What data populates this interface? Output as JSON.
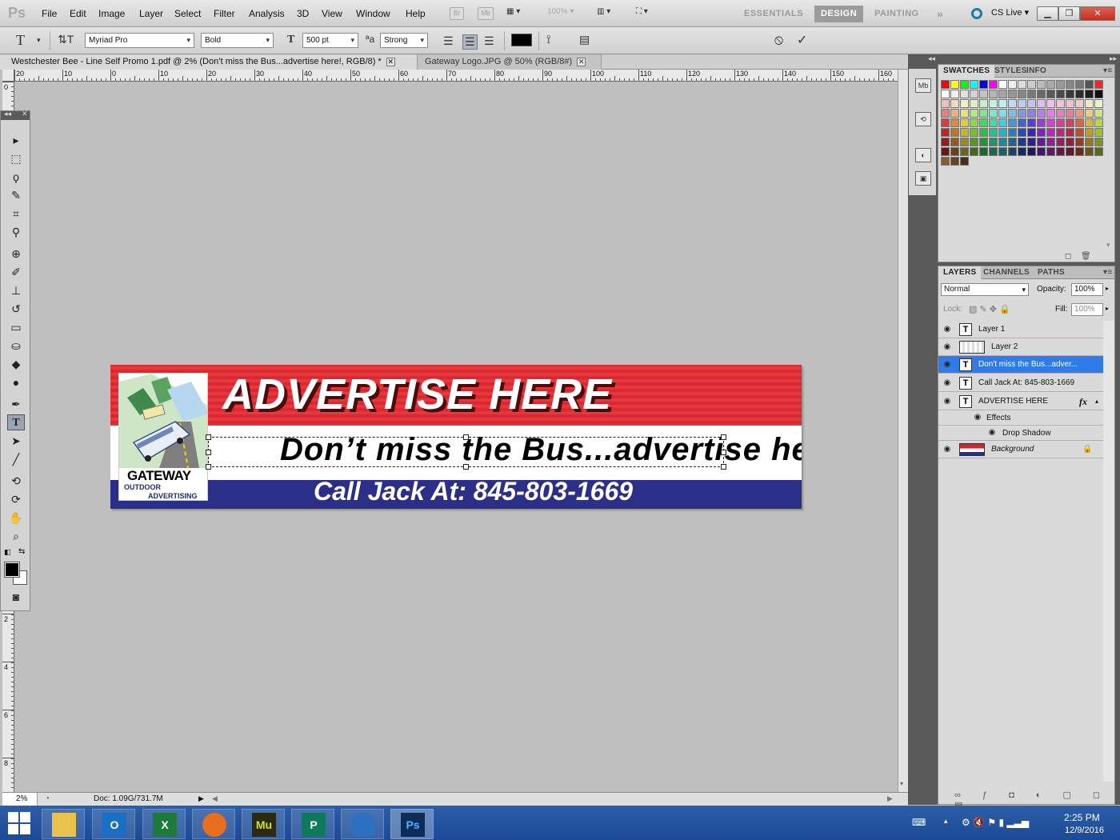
{
  "app": {
    "logo": "Ps",
    "menu": [
      "File",
      "Edit",
      "Image",
      "Layer",
      "Select",
      "Filter",
      "Analysis",
      "3D",
      "View",
      "Window",
      "Help"
    ],
    "zoom_readout": "100%",
    "bridge_icon": "Br",
    "mini_bridge_icon": "Mb",
    "workspaces": [
      "ESSENTIALS",
      "DESIGN",
      "PAINTING"
    ],
    "active_workspace": "DESIGN",
    "more_workspaces": "»",
    "cs_live": "CS Live"
  },
  "options": {
    "font_family": "Myriad Pro",
    "font_style": "Bold",
    "font_size": "500 pt",
    "antialias": "Strong",
    "cancel_glyph": "⦸",
    "commit_glyph": "✓"
  },
  "tabs": [
    {
      "label": "Westchester Bee - Line Self Promo 1.pdf @ 2% (Don’t miss the Bus...advertise here!, RGB/8) *",
      "close": "✕"
    },
    {
      "label": "Gateway Logo.JPG @ 50% (RGB/8#)",
      "close": "✕"
    }
  ],
  "ruler": {
    "top_labels": [
      "20",
      "10",
      "0",
      "10",
      "20",
      "30",
      "40",
      "50",
      "60",
      "70",
      "80",
      "90",
      "100",
      "110",
      "120",
      "130",
      "140",
      "150",
      "160"
    ],
    "left_labels": [
      "0",
      "2",
      "4",
      "6",
      "8"
    ]
  },
  "artwork": {
    "headline": "ADVERTISE HERE",
    "subline": "Don’t miss the Bus...advertise here!",
    "phone": "Call Jack At: 845-803-1669",
    "logo_name": "GATEWAY",
    "logo_sub1": "OUTDOOR",
    "logo_sub2": "ADVERTISING"
  },
  "status": {
    "zoom": "2%",
    "doc": "Doc: 1.09G/731.7M"
  },
  "swatches_panel": {
    "tabs": [
      "SWATCHES",
      "STYLES",
      "INFO"
    ],
    "active_tab": "SWATCHES"
  },
  "layers_panel": {
    "tabs": [
      "LAYERS",
      "CHANNELS",
      "PATHS"
    ],
    "active_tab": "LAYERS",
    "blend_mode": "Normal",
    "opacity_label": "Opacity:",
    "opacity": "100%",
    "lock_label": "Lock:",
    "fill_label": "Fill:",
    "fill": "100%",
    "layers": [
      {
        "name": "Layer 1",
        "type": "text",
        "selected": false
      },
      {
        "name": "Layer 2",
        "type": "pixel",
        "selected": false
      },
      {
        "name": "Don't miss the Bus...adver...",
        "type": "text",
        "selected": true
      },
      {
        "name": "Call Jack At: 845-803-1669",
        "type": "text",
        "selected": false
      },
      {
        "name": "ADVERTISE HERE",
        "type": "text",
        "selected": false,
        "fx": "fx"
      }
    ],
    "effects_label": "Effects",
    "drop_shadow_label": "Drop Shadow",
    "background_label": "Background"
  },
  "taskbar": {
    "time": "2:25 PM",
    "date": "12/9/2016",
    "apps": [
      "explorer",
      "outlook",
      "excel",
      "firefox",
      "muse",
      "publisher",
      "app6",
      "photoshop"
    ],
    "app_letters": [
      "",
      "O",
      "X",
      "",
      "Mu",
      "P",
      "",
      "Ps"
    ]
  },
  "colors": {
    "band_red": "#d8232c",
    "band_blue": "#2c2f88",
    "selection_blue": "#2f7be8",
    "taskbar": "#1c4a96"
  }
}
